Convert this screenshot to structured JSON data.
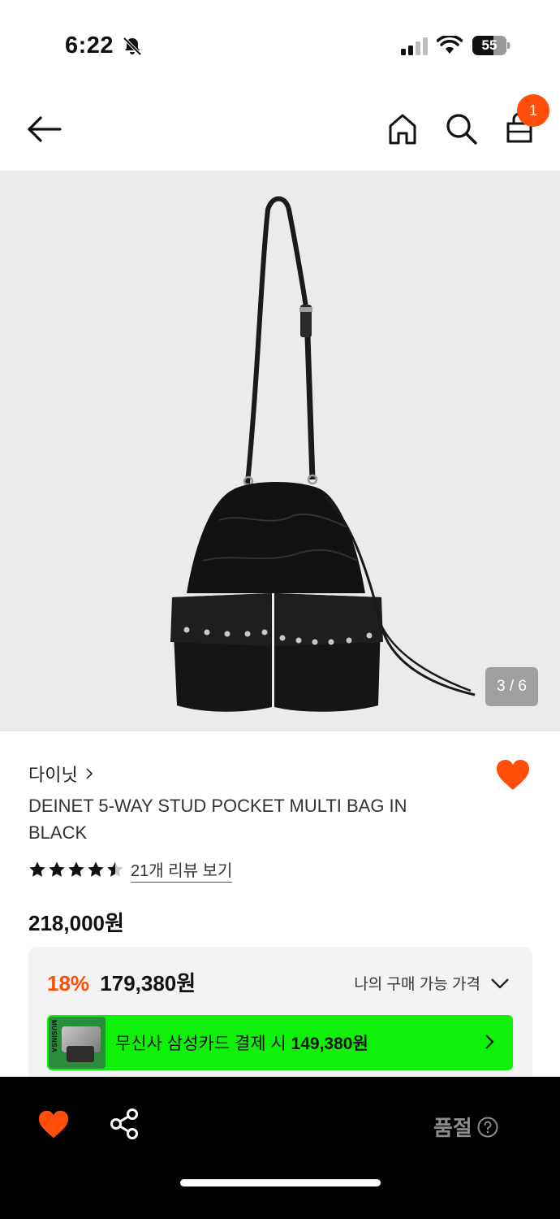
{
  "status_bar": {
    "time": "6:22",
    "battery": "55"
  },
  "header": {
    "cart_count": "1"
  },
  "gallery": {
    "counter": "3 / 6"
  },
  "product": {
    "brand": "다이닛",
    "title": "DEINET 5-WAY STUD POCKET MULTI BAG IN BLACK",
    "rating": 4.5,
    "review_link": "21개 리뷰 보기",
    "original_price": "218,000원"
  },
  "price_box": {
    "discount_rate": "18%",
    "discount_price": "179,380원",
    "my_price_label": "나의 구매 가능 가격",
    "card_banner": {
      "thumb_brand": "MUSINSA",
      "text_prefix": "무신사 삼성카드 결제 시 ",
      "amount": "149,380원"
    }
  },
  "bottom_bar": {
    "soldout_label": "품절"
  },
  "colors": {
    "accent": "#ff4d0a",
    "card_banner": "#10f10a",
    "image_bg": "#ebebeb"
  },
  "icons": {
    "back": "arrow-left-icon",
    "home": "home-icon",
    "search": "search-icon",
    "cart": "shopping-bag-icon",
    "like": "heart-icon",
    "share": "share-icon",
    "help": "question-circle-icon"
  }
}
